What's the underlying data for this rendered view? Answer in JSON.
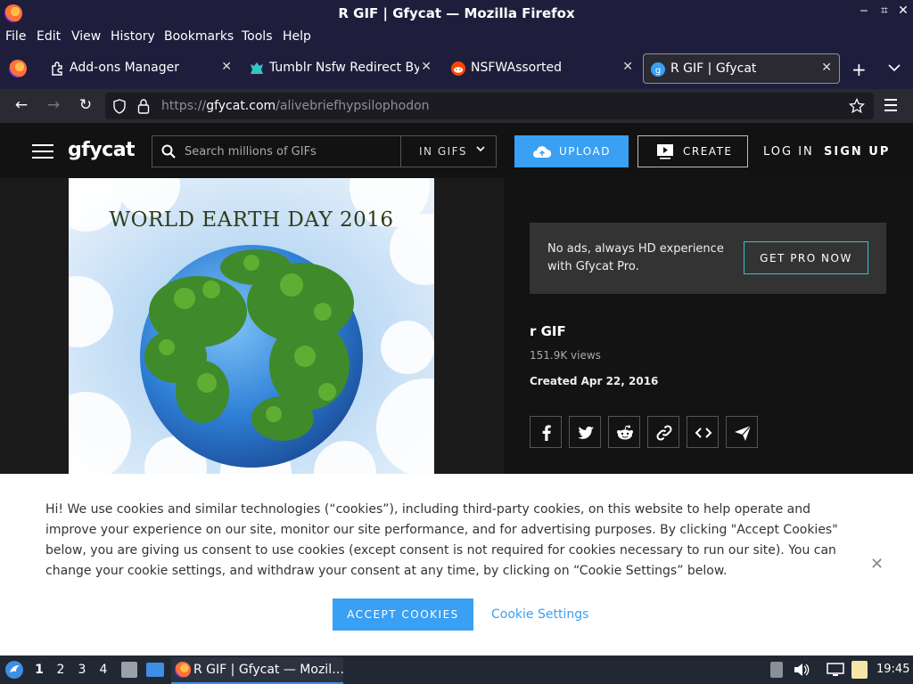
{
  "window": {
    "title": "R GIF | Gfycat — Mozilla Firefox"
  },
  "menu": [
    "File",
    "Edit",
    "View",
    "History",
    "Bookmarks",
    "Tools",
    "Help"
  ],
  "tabs": [
    {
      "label": "Add-ons Manager"
    },
    {
      "label": "Tumblr Nsfw Redirect Byp"
    },
    {
      "label": "NSFWAssorted"
    },
    {
      "label": "R GIF | Gfycat"
    }
  ],
  "url": {
    "prefix": "https://",
    "host": "gfycat.com",
    "path": "/alivebriefhypsilophodon"
  },
  "header": {
    "logo": "gfycat",
    "search_placeholder": "Search millions of GIFs",
    "scope": "IN GIFS",
    "upload": "UPLOAD",
    "create": "CREATE",
    "login": "LOG IN",
    "signup": "SIGN UP"
  },
  "gif": {
    "caption": "WORLD EARTH DAY 2016"
  },
  "promo": {
    "text": "No ads, always HD experience with Gfycat Pro.",
    "cta": "GET PRO NOW"
  },
  "info": {
    "title": "r GIF",
    "views": "151.9K views",
    "created": "Created Apr 22, 2016"
  },
  "cookie": {
    "text": "Hi! We use cookies and similar technologies (“cookies”), including third-party cookies, on this website to help operate and improve your experience on our site, monitor our site performance, and for advertising purposes. By clicking \"Accept Cookies\" below, you are giving us consent to use cookies (except consent is not required for cookies necessary to run our site). You can change your cookie settings, and withdraw your consent at any time, by clicking on “Cookie Settings” below.",
    "accept": "ACCEPT COOKIES",
    "settings": "Cookie Settings"
  },
  "taskbar": {
    "workspaces": [
      "1",
      "2",
      "3",
      "4"
    ],
    "task": "R GIF | Gfycat — Mozil…",
    "clock": "19:45"
  },
  "colors": {
    "accent": "#39a0f3",
    "pro_border": "#36c2d1",
    "titlebar": "#1e1e3c"
  }
}
